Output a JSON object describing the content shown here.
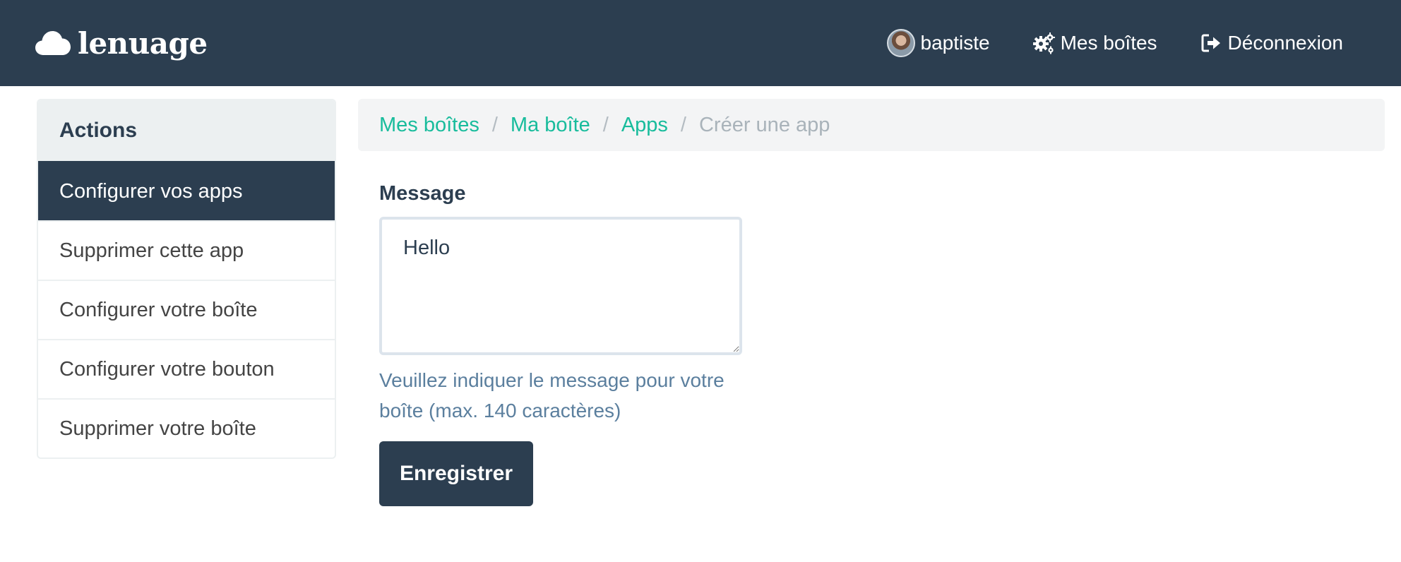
{
  "navbar": {
    "brand": "lenuage",
    "brand_icon": "cloud-icon",
    "user": {
      "name": "baptiste",
      "avatar": "user-avatar"
    },
    "links": [
      {
        "label": "Mes boîtes",
        "icon": "cogs-icon"
      },
      {
        "label": "Déconnexion",
        "icon": "sign-out-icon"
      }
    ]
  },
  "sidebar": {
    "heading": "Actions",
    "items": [
      {
        "label": "Configurer vos apps",
        "active": true
      },
      {
        "label": "Supprimer cette app",
        "active": false
      },
      {
        "label": "Configurer votre boîte",
        "active": false
      },
      {
        "label": "Configurer votre bouton",
        "active": false
      },
      {
        "label": "Supprimer votre boîte",
        "active": false
      }
    ]
  },
  "breadcrumb": {
    "items": [
      "Mes boîtes",
      "Ma boîte",
      "Apps"
    ],
    "separator": "/",
    "current": "Créer une app"
  },
  "form": {
    "label": "Message",
    "value": "Hello",
    "help": "Veuillez indiquer le message pour votre boîte (max. 140 caractères)",
    "submit": "Enregistrer"
  },
  "colors": {
    "navbar_bg": "#2c3e50",
    "accent_link": "#18bc9c",
    "help_text": "#5b7f9e",
    "active_item_bg": "#2c3e50"
  }
}
